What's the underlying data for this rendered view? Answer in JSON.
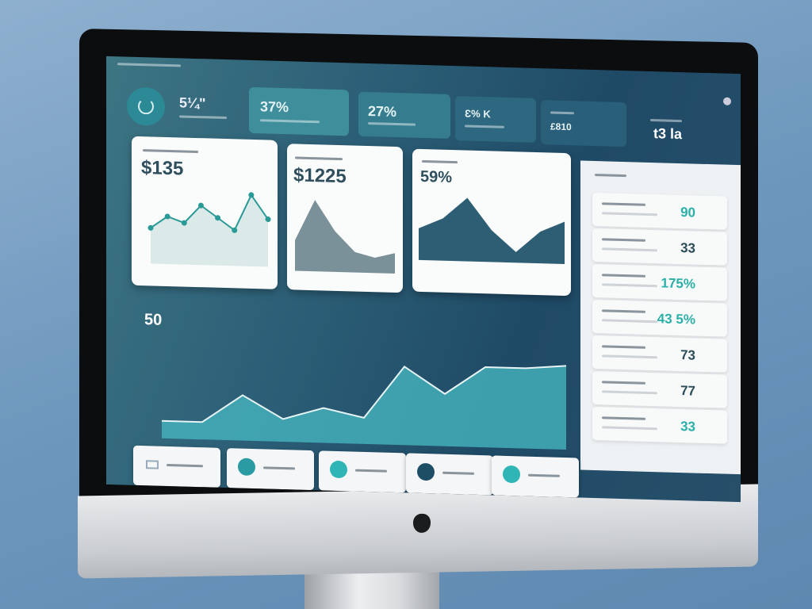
{
  "header": {
    "logo_icon": "refresh-circle-icon",
    "value": "5¼\""
  },
  "kpis": [
    {
      "value": "37%"
    },
    {
      "value": "27%"
    },
    {
      "value": "Ɛ% K"
    },
    {
      "value": "£810"
    },
    {
      "value": "t3 la"
    }
  ],
  "cards": [
    {
      "value": "$135"
    },
    {
      "value": "$1225"
    },
    {
      "value": "59%"
    }
  ],
  "main_chart": {
    "value": "50"
  },
  "list_values": [
    "90",
    "33",
    "175%",
    "43 5%",
    "73",
    "77",
    "33"
  ],
  "apple_logo": "apple-logo-icon",
  "colors": {
    "accent": "#2fa8ad",
    "screen": "#1f4a66",
    "teal_area": "#5cc3c0"
  },
  "chart_data": [
    {
      "type": "line",
      "title": "",
      "values": [
        3,
        4,
        3.5,
        5,
        4,
        3,
        6,
        4
      ]
    },
    {
      "type": "area",
      "title": "",
      "values": [
        3,
        7,
        4,
        2,
        1.5,
        2
      ]
    },
    {
      "type": "area",
      "title": "",
      "values": [
        3,
        4,
        6,
        3,
        1,
        3,
        4
      ]
    },
    {
      "type": "area",
      "title": "",
      "values": [
        1,
        1,
        2.6,
        1.3,
        2,
        1.5,
        4.5,
        3,
        4.6,
        4.6,
        4.8
      ]
    }
  ]
}
